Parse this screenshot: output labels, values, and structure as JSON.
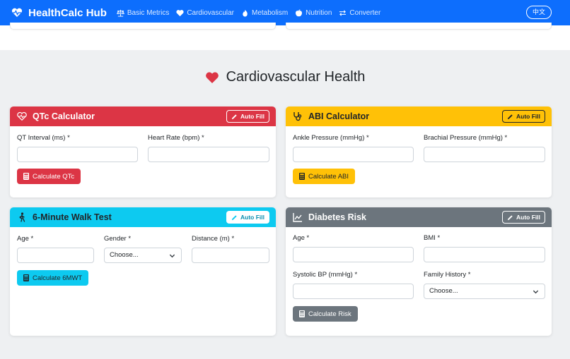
{
  "navbar": {
    "brand": "HealthCalc Hub",
    "links": [
      {
        "label": "Basic Metrics",
        "icon": "scale-icon"
      },
      {
        "label": "Cardiovascular",
        "icon": "heart-icon"
      },
      {
        "label": "Metabolism",
        "icon": "flame-icon"
      },
      {
        "label": "Nutrition",
        "icon": "apple-icon"
      },
      {
        "label": "Converter",
        "icon": "swap-icon"
      }
    ],
    "lang_button": "中文"
  },
  "section": {
    "title": "Cardiovascular Health",
    "icon": "heart-icon"
  },
  "cards": {
    "qtc": {
      "title": "QTc Calculator",
      "auto_fill": "Auto Fill",
      "labels": [
        "QT Interval (ms) *",
        "Heart Rate (bpm) *"
      ],
      "button": "Calculate QTc"
    },
    "abi": {
      "title": "ABI Calculator",
      "auto_fill": "Auto Fill",
      "labels": [
        "Ankle Pressure (mmHg) *",
        "Brachial Pressure (mmHg) *"
      ],
      "button": "Calculate ABI"
    },
    "walk": {
      "title": "6-Minute Walk Test",
      "auto_fill": "Auto Fill",
      "labels": [
        "Age *",
        "Gender *",
        "Distance (m) *"
      ],
      "gender_selected": "Choose...",
      "button": "Calculate 6MWT"
    },
    "diabetes": {
      "title": "Diabetes Risk",
      "auto_fill": "Auto Fill",
      "labels": [
        "Age *",
        "BMI *",
        "Systolic BP (mmHg) *",
        "Family History *"
      ],
      "family_selected": "Choose...",
      "button": "Calculate Risk"
    }
  },
  "colors": {
    "primary": "#0d6efd",
    "danger": "#dc3545",
    "warning": "#ffc107",
    "info": "#0dcaf0",
    "secondary": "#6c757d"
  }
}
